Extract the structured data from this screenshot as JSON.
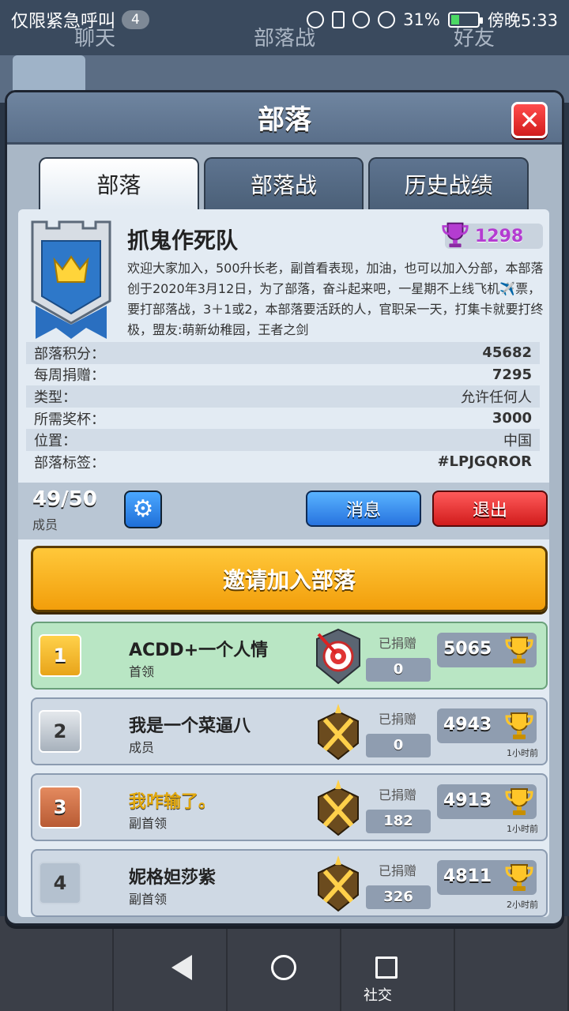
{
  "status_bar": {
    "carrier_text": "仅限紧急呼叫",
    "notification_count": "4",
    "battery": "31%",
    "time": "傍晚5:33"
  },
  "background": {
    "tabs": [
      "聊天",
      "部落战",
      "好友"
    ],
    "bottom_label": "社交"
  },
  "modal": {
    "title": "部落",
    "close_icon": "close-icon",
    "tabs": [
      {
        "label": "部落",
        "active": true
      },
      {
        "label": "部落战",
        "active": false
      },
      {
        "label": "历史战绩",
        "active": false
      }
    ],
    "clan": {
      "name": "抓鬼作死队",
      "trophies": "1298",
      "description": "欢迎大家加入，500升长老，副首看表现，加油，也可以加入分部，本部落创于2020年3月12日，为了部落，奋斗起来吧，一星期不上线飞机✈️票，要打部落战，3＋1或2，本部落要活跃的人，官职呆一天，打集卡就要打终极，盟友:萌新幼稚园，王者之剑",
      "stats": [
        {
          "label": "部落积分：",
          "value": "45682"
        },
        {
          "label": "每周捐赠：",
          "value": "7295"
        },
        {
          "label": "类型：",
          "value": "允许任何人"
        },
        {
          "label": "所需奖杯：",
          "value": "3000"
        },
        {
          "label": "位置：",
          "value": "中国"
        },
        {
          "label": "部落标签：",
          "value": "#LPJGQROR"
        }
      ]
    },
    "members_bar": {
      "count": "49/50",
      "label": "成员",
      "message_btn": "消息",
      "leave_btn": "退出"
    },
    "invite_btn": "邀请加入部落",
    "members": [
      {
        "rank": "1",
        "name": "ACDD+一个人情",
        "role": "首领",
        "donated_label": "已捐赠",
        "donated": "0",
        "trophies": "5065",
        "time": ""
      },
      {
        "rank": "2",
        "name": "我是一个菜逼八",
        "role": "成员",
        "donated_label": "已捐赠",
        "donated": "0",
        "trophies": "4943",
        "time": "1小时前"
      },
      {
        "rank": "3",
        "name": "我咋输了。",
        "role": "副首领",
        "donated_label": "已捐赠",
        "donated": "182",
        "trophies": "4913",
        "time": "1小时前"
      },
      {
        "rank": "4",
        "name": "妮格妲莎紫",
        "role": "副首领",
        "donated_label": "已捐赠",
        "donated": "326",
        "trophies": "4811",
        "time": "2小时前"
      }
    ]
  }
}
